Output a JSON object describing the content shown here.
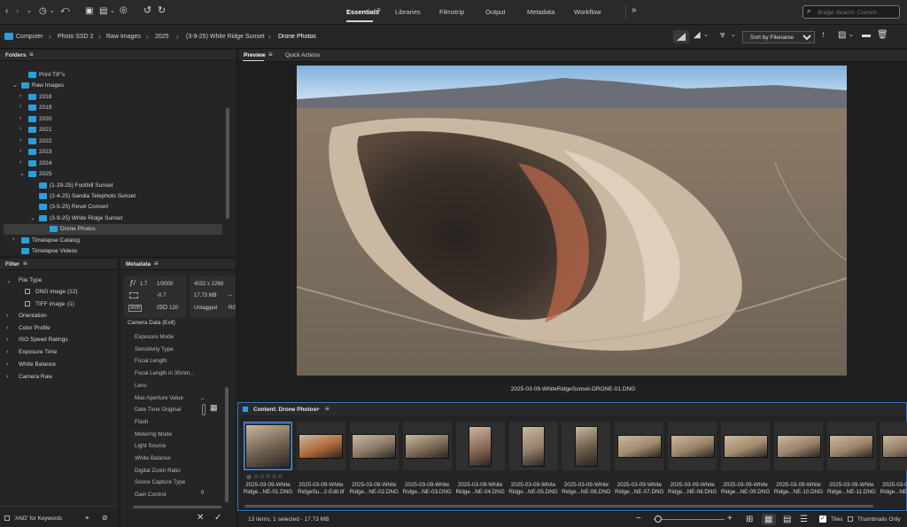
{
  "topbar": {
    "nav": [
      "Essentials",
      "Libraries",
      "Filmstrip",
      "Output",
      "Metadata",
      "Workflow"
    ],
    "search_placeholder": "Bridge Search: Current ."
  },
  "path": [
    "Computer",
    "Photo SSD 2",
    "Raw Images",
    "2025",
    "(3-9-25) White Ridge Sunset",
    "Drone Photos"
  ],
  "sort_label": "Sort by Filename",
  "folders": {
    "title": "Folders",
    "items": [
      {
        "label": "Print TIF's",
        "depth": 2,
        "chev": ""
      },
      {
        "label": "Raw Images",
        "depth": 1,
        "chev": "v"
      },
      {
        "label": "2018",
        "depth": 2,
        "chev": ">"
      },
      {
        "label": "2019",
        "depth": 2,
        "chev": ">"
      },
      {
        "label": "2020",
        "depth": 2,
        "chev": ">"
      },
      {
        "label": "2021",
        "depth": 2,
        "chev": ">"
      },
      {
        "label": "2022",
        "depth": 2,
        "chev": ">"
      },
      {
        "label": "2023",
        "depth": 2,
        "chev": ">"
      },
      {
        "label": "2024",
        "depth": 2,
        "chev": ">"
      },
      {
        "label": "2025",
        "depth": 2,
        "chev": "v"
      },
      {
        "label": "(1-29-25) Foothill Sunset",
        "depth": 3,
        "chev": ""
      },
      {
        "label": "(2-4-25) Sandia Telephoto Sunset",
        "depth": 3,
        "chev": ""
      },
      {
        "label": "(3-5-25) Revel Concert",
        "depth": 3,
        "chev": ""
      },
      {
        "label": "(3-9-25) White Ridge Sunset",
        "depth": 3,
        "chev": "v"
      },
      {
        "label": "Drone Photos",
        "depth": 4,
        "chev": "",
        "selected": true
      },
      {
        "label": "Timelapse Catalog",
        "depth": 1,
        "chev": ">"
      },
      {
        "label": "Timelapse Videos",
        "depth": 1,
        "chev": ""
      }
    ]
  },
  "filter": {
    "title": "Filter",
    "file_type_label": "File Type",
    "file_types": [
      {
        "label": "DNG image",
        "count": "(12)"
      },
      {
        "label": "TIFF image",
        "count": "(1)"
      }
    ],
    "categories": [
      "Orientation",
      "Color Profile",
      "ISO Speed Ratings",
      "Exposure Time",
      "White Balance",
      "Camera Raw"
    ],
    "and_keywords": "'AND' for Keywords"
  },
  "metadata": {
    "title": "Metadata",
    "aperture": "1.7",
    "shutter": "1/3000",
    "dimensions": "4032 x 2268",
    "exposure_comp": "-0.7",
    "file_size": "17.73 MB",
    "iso_label": "ISO",
    "iso": "120",
    "untagged": "Untagged",
    "color_mode": "RG",
    "dash": "--",
    "section": "Camera Data (Exif)",
    "fields": [
      "Exposure Mode",
      "Sensitivity Type",
      "Focal Length",
      "Focal Length in 35mm...",
      "Lens",
      "Max Aperture Value",
      "Date Time Original",
      "Flash",
      "Metering Mode",
      "Light Source",
      "White Balance",
      "Digital Zoom Ratio",
      "Scene Capture Type",
      "Gain Control"
    ],
    "gain_value": "0",
    "max_ap_value": "_"
  },
  "preview": {
    "tabs": [
      "Preview",
      "Quick Actions"
    ],
    "caption": "2025-03-09-WhiteRidgeSunset-DRONE-01.DNG"
  },
  "content": {
    "title": "Content: Drone Photos",
    "add": "+",
    "thumbnails": [
      {
        "line1": "2025-03-09-White",
        "line2": "Ridge...NE-01.DNG"
      },
      {
        "line1": "2025-03-09-White",
        "line2": "RidgeSu...2-Edit.tif"
      },
      {
        "line1": "2025-03-09-White",
        "line2": "Ridge...NE-02.DNG"
      },
      {
        "line1": "2025-03-09-White",
        "line2": "Ridge...NE-03.DNG"
      },
      {
        "line1": "2025-03-09-White",
        "line2": "Ridge...NE-04.DNG"
      },
      {
        "line1": "2025-03-09-White",
        "line2": "Ridge...NE-05.DNG"
      },
      {
        "line1": "2025-03-09-White",
        "line2": "Ridge...NE-06.DNG"
      },
      {
        "line1": "2025-03-09-White",
        "line2": "Ridge...NE-07.DNG"
      },
      {
        "line1": "2025-03-09-White",
        "line2": "Ridge...NE-08.DNG"
      },
      {
        "line1": "2025-03-09-White",
        "line2": "Ridge...NE-09.DNG"
      },
      {
        "line1": "2025-03-09-White",
        "line2": "Ridge...NE-10.DNG"
      },
      {
        "line1": "2025-03-09-White",
        "line2": "Ridge...NE-11.DNG"
      },
      {
        "line1": "2025-03-09-White",
        "line2": "Ridge...NE-12.DNG"
      }
    ]
  },
  "status": {
    "text": "13 items, 1 selected - 17.73 MB",
    "tiles": "Tiles",
    "thumbnails_only": "Thumbnails Only",
    "minus": "−",
    "plus": "+"
  },
  "colors": {
    "accent": "#2a9fe0",
    "folder": "#2a9fe0",
    "selection": "#4a8fd6"
  }
}
